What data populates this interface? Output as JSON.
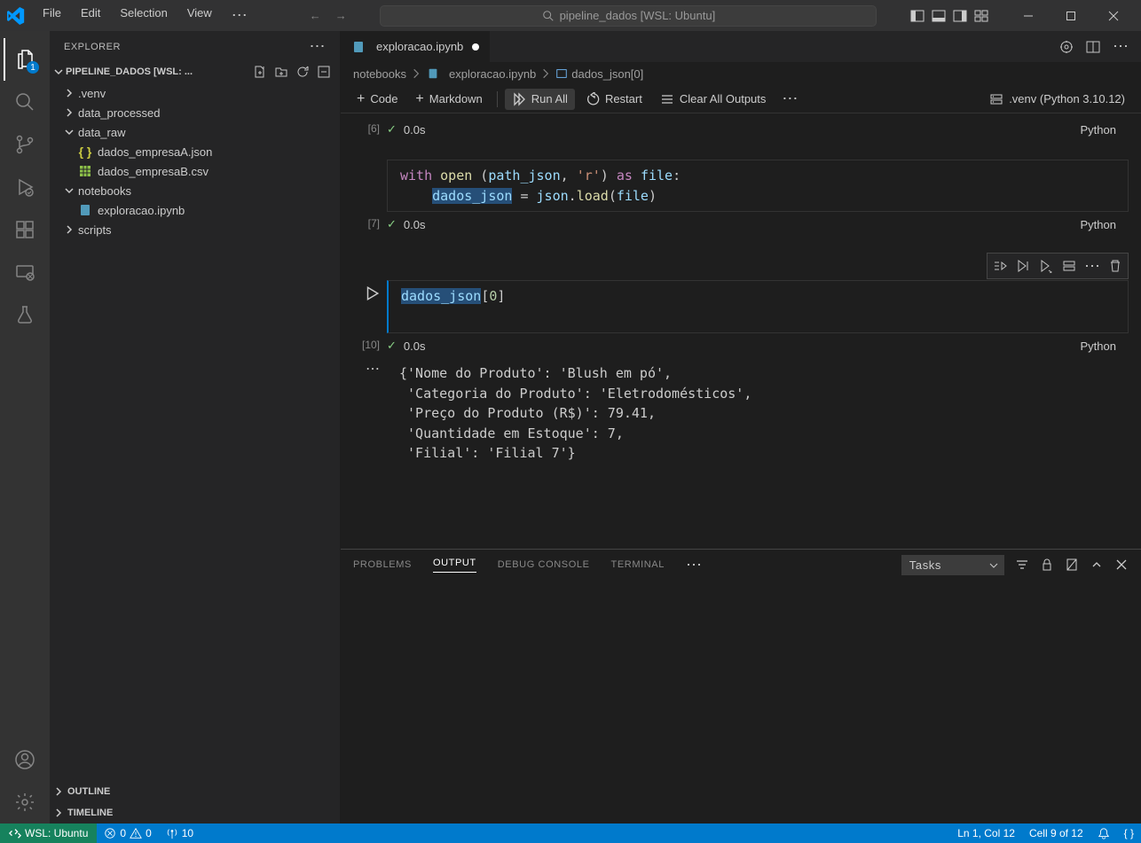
{
  "titlebar": {
    "menus": [
      "File",
      "Edit",
      "Selection",
      "View"
    ],
    "search": "pipeline_dados [WSL: Ubuntu]"
  },
  "activity": {
    "explorer_badge": "1"
  },
  "sidebar": {
    "title": "EXPLORER",
    "folder": "PIPELINE_DADOS [WSL: ...",
    "tree": {
      "venv": ".venv",
      "data_processed": "data_processed",
      "data_raw": "data_raw",
      "file_json": "dados_empresaA.json",
      "file_csv": "dados_empresaB.csv",
      "notebooks": "notebooks",
      "file_ipynb": "exploracao.ipynb",
      "scripts": "scripts"
    },
    "outline": "OUTLINE",
    "timeline": "TIMELINE"
  },
  "tab": {
    "name": "exploracao.ipynb"
  },
  "breadcrumb": {
    "p1": "notebooks",
    "p2": "exploracao.ipynb",
    "p3": "dados_json[0]"
  },
  "nb_toolbar": {
    "code": "Code",
    "markdown": "Markdown",
    "runall": "Run All",
    "restart": "Restart",
    "clear": "Clear All Outputs",
    "kernel": ".venv (Python 3.10.12)"
  },
  "cells": {
    "c6": {
      "num": "[6]",
      "time": "0.0s",
      "lang": "Python"
    },
    "c7": {
      "num": "[7]",
      "time": "0.0s",
      "lang": "Python",
      "code": {
        "with": "with",
        "open": "open",
        "pathjson": "path_json",
        "r": "'r'",
        "as": "as",
        "file": "file",
        "dados": "dados_json",
        "json": "json",
        "load": "load"
      }
    },
    "c10": {
      "num": "[10]",
      "time": "0.0s",
      "lang": "Python",
      "code": {
        "dados": "dados_json",
        "idx": "0"
      },
      "output": "{'Nome do Produto': 'Blush em pó',\n 'Categoria do Produto': 'Eletrodomésticos',\n 'Preço do Produto (R$)': 79.41,\n 'Quantidade em Estoque': 7,\n 'Filial': 'Filial 7'}"
    }
  },
  "panel": {
    "problems": "PROBLEMS",
    "output": "OUTPUT",
    "debug": "DEBUG CONSOLE",
    "terminal": "TERMINAL",
    "select": "Tasks"
  },
  "statusbar": {
    "remote": "WSL: Ubuntu",
    "errors": "0",
    "warnings": "0",
    "ports": "10",
    "lncol": "Ln 1, Col 12",
    "cell": "Cell 9 of 12"
  }
}
